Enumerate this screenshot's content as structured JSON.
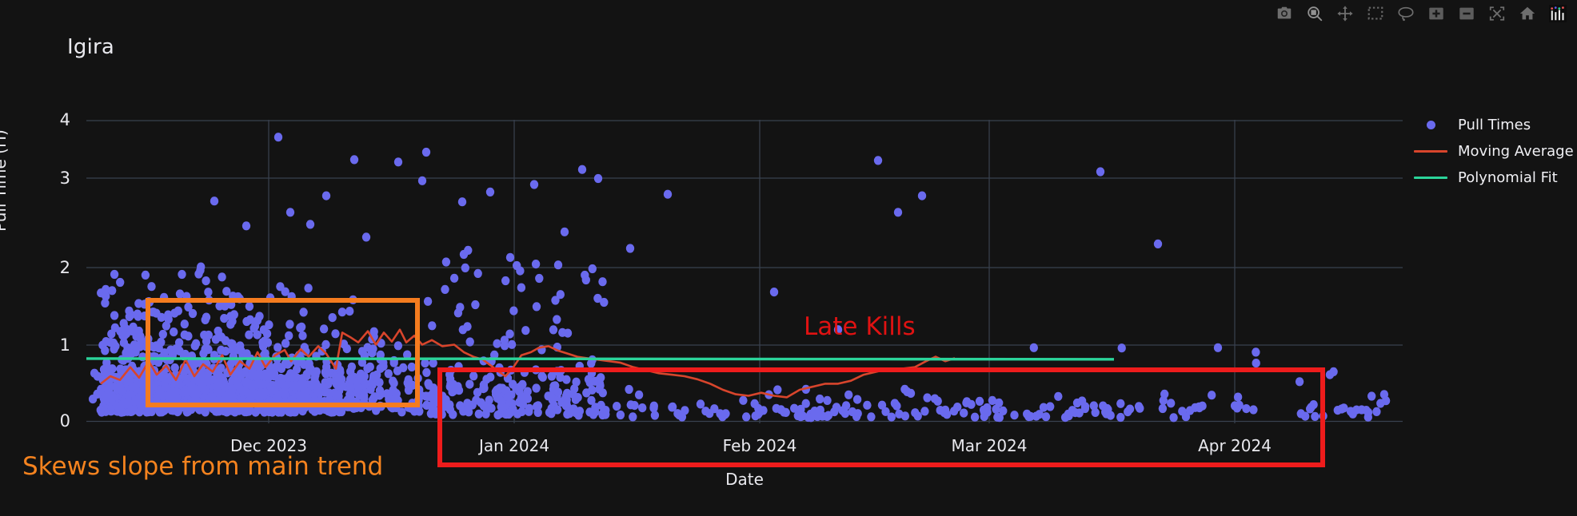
{
  "toolbar": {
    "buttons": [
      {
        "name": "camera-icon",
        "label": "Save figure"
      },
      {
        "name": "zoom-icon",
        "label": "Zoom"
      },
      {
        "name": "pan-icon",
        "label": "Pan"
      },
      {
        "name": "box-select-icon",
        "label": "Box select"
      },
      {
        "name": "lasso-select-icon",
        "label": "Lasso select"
      },
      {
        "name": "zoom-in-icon",
        "label": "Zoom in"
      },
      {
        "name": "zoom-out-icon",
        "label": "Zoom out"
      },
      {
        "name": "autoscale-icon",
        "label": "Autoscale"
      },
      {
        "name": "home-icon",
        "label": "Reset axes"
      },
      {
        "name": "plotly-logo-icon",
        "label": "Produced with Plotly"
      }
    ]
  },
  "chart_data": {
    "type": "scatter",
    "title": "Igira",
    "xlabel": "Date",
    "ylabel": "Pull Time (H)",
    "xticklabels": [
      "Dec 2023",
      "Jan 2024",
      "Feb 2024",
      "Mar 2024",
      "Apr 2024"
    ],
    "yticklabels": [
      "0",
      "1",
      "2",
      "3",
      "4"
    ],
    "ylim": [
      -0.15,
      4.25
    ],
    "grid": true,
    "legend_position": "right",
    "colors": {
      "background": "#131313",
      "grid": "#3a4454",
      "text": "#e9e9ee",
      "pull_times": "#6a6aee",
      "moving_average": "#d8452c",
      "polynomial_fit": "#2bd49a",
      "annotation_orange": "#f5831f",
      "annotation_red": "#ee1c1c"
    },
    "series": [
      {
        "name": "Pull Times",
        "type": "scatter",
        "color": "#6a6aee",
        "marker": "circle",
        "note": "Dense cluster Nov-Dec 2023 mostly 0-1.8 H with outliers to 3.8 H; sparse low scatter Jan-Apr 2024 mostly under 0.6 H"
      },
      {
        "name": "Moving Average",
        "type": "line",
        "color": "#d8452c",
        "note": "Rises from ~0.55 H in Nov 2023 to ~1.2 H late Dec 2023, declines to ~0.35 H mid Feb 2024, recovers to ~0.7 H by Mar 2024"
      },
      {
        "name": "Polynomial Fit",
        "type": "line",
        "color": "#2bd49a",
        "note": "Nearly flat near 0.83 H across the full date range"
      }
    ],
    "annotations": [
      {
        "name": "late-kills-label",
        "text": "Late Kills",
        "color": "#e01212"
      },
      {
        "name": "skews-slope-label",
        "text": "Skews slope from main trend",
        "color": "#f5831f"
      },
      {
        "name": "main-trend-box",
        "shape": "rectangle",
        "color": "#f5831f"
      },
      {
        "name": "late-kills-box",
        "shape": "rectangle",
        "color": "#ee1c1c"
      }
    ]
  },
  "legend": {
    "items": [
      {
        "label": "Pull Times",
        "mark": "dot",
        "color": "#6a6aee"
      },
      {
        "label": "Moving Average",
        "mark": "line",
        "color": "#d8452c"
      },
      {
        "label": "Polynomial Fit",
        "mark": "line",
        "color": "#2bd49a"
      }
    ]
  }
}
